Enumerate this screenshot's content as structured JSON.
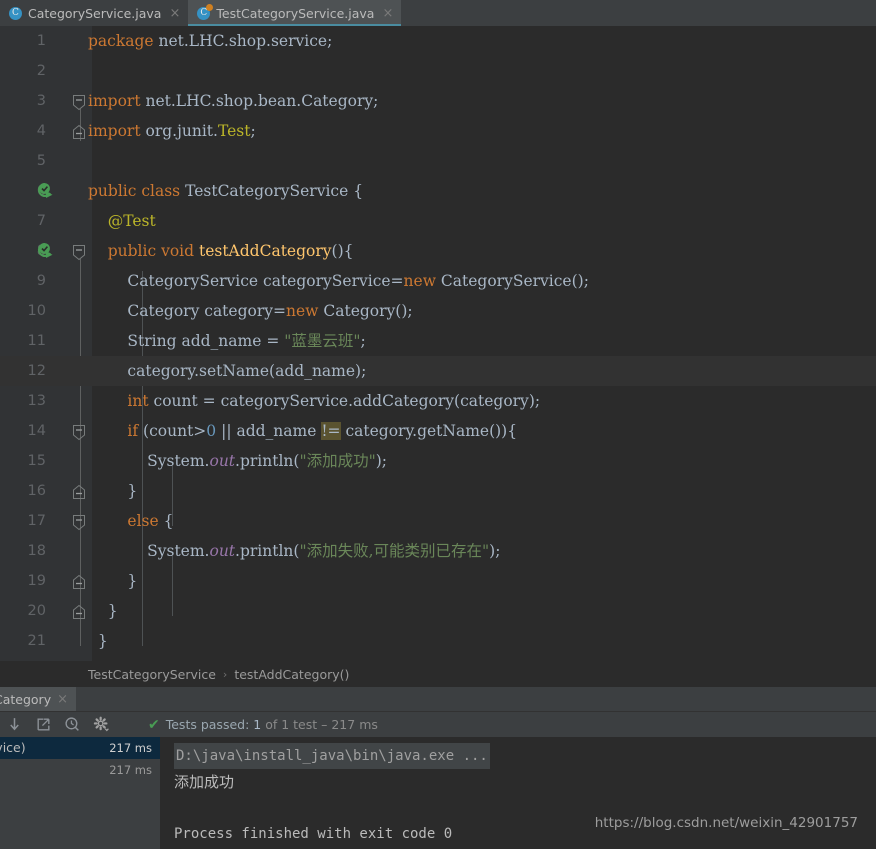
{
  "tabs": [
    {
      "label": "CategoryService.java",
      "icon": "java-class-icon",
      "active": false,
      "badge": ""
    },
    {
      "label": "TestCategoryService.java",
      "icon": "java-class-icon",
      "active": true,
      "badge": "run-badge"
    }
  ],
  "editor": {
    "lines": [
      {
        "n": "1",
        "tokens": [
          {
            "t": "package ",
            "c": "kw"
          },
          {
            "t": "net.LHC.shop.service;",
            "c": "pl"
          }
        ],
        "indent": 0,
        "gutter_run": false,
        "fold": ""
      },
      {
        "n": "2",
        "tokens": [],
        "indent": 0,
        "gutter_run": false,
        "fold": ""
      },
      {
        "n": "3",
        "tokens": [
          {
            "t": "import ",
            "c": "kw"
          },
          {
            "t": "net.LHC.shop.bean.Category;",
            "c": "pl"
          }
        ],
        "indent": 0,
        "gutter_run": false,
        "fold": "collapse-top"
      },
      {
        "n": "4",
        "tokens": [
          {
            "t": "import ",
            "c": "kw"
          },
          {
            "t": "org.junit.",
            "c": "pl"
          },
          {
            "t": "Test",
            "c": "ann"
          },
          {
            "t": ";",
            "c": "pl"
          }
        ],
        "indent": 0,
        "gutter_run": false,
        "fold": "collapse-bottom"
      },
      {
        "n": "5",
        "tokens": [],
        "indent": 0,
        "gutter_run": false,
        "fold": ""
      },
      {
        "n": "6",
        "tokens": [
          {
            "t": "public class ",
            "c": "kw"
          },
          {
            "t": "TestCategoryService ",
            "c": "pl"
          },
          {
            "t": "{",
            "c": "pl"
          }
        ],
        "indent": 0,
        "gutter_run": true,
        "fold": ""
      },
      {
        "n": "7",
        "tokens": [
          {
            "t": "    @Test",
            "c": "ann"
          }
        ],
        "indent": 0,
        "gutter_run": false,
        "fold": ""
      },
      {
        "n": "8",
        "tokens": [
          {
            "t": "    ",
            "c": "pl"
          },
          {
            "t": "public void ",
            "c": "kw"
          },
          {
            "t": "testAddCategory",
            "c": "fn"
          },
          {
            "t": "(){",
            "c": "pl"
          }
        ],
        "indent": 0,
        "gutter_run": true,
        "fold": "collapse-top"
      },
      {
        "n": "9",
        "tokens": [
          {
            "t": "        CategoryService categoryService=",
            "c": "pl"
          },
          {
            "t": "new ",
            "c": "kw"
          },
          {
            "t": "CategoryService();",
            "c": "pl"
          }
        ],
        "indent": 0,
        "gutter_run": false,
        "fold": ""
      },
      {
        "n": "10",
        "tokens": [
          {
            "t": "        Category category=",
            "c": "pl"
          },
          {
            "t": "new ",
            "c": "kw"
          },
          {
            "t": "Category();",
            "c": "pl"
          }
        ],
        "indent": 0,
        "gutter_run": false,
        "fold": ""
      },
      {
        "n": "11",
        "tokens": [
          {
            "t": "        String add_name = ",
            "c": "pl"
          },
          {
            "t": "\"蓝墨云班\"",
            "c": "str"
          },
          {
            "t": ";",
            "c": "pl"
          }
        ],
        "indent": 0,
        "gutter_run": false,
        "fold": ""
      },
      {
        "n": "12",
        "tokens": [
          {
            "t": "        category.setName(add_name);",
            "c": "pl"
          }
        ],
        "indent": 0,
        "gutter_run": false,
        "fold": "",
        "current": true
      },
      {
        "n": "13",
        "tokens": [
          {
            "t": "        ",
            "c": "pl"
          },
          {
            "t": "int ",
            "c": "kw"
          },
          {
            "t": "count = categoryService.addCategory(category);",
            "c": "pl"
          }
        ],
        "indent": 0,
        "gutter_run": false,
        "fold": ""
      },
      {
        "n": "14",
        "tokens": [
          {
            "t": "        ",
            "c": "pl"
          },
          {
            "t": "if ",
            "c": "kw"
          },
          {
            "t": "(count>",
            "c": "pl"
          },
          {
            "t": "0",
            "c": "num"
          },
          {
            "t": " || add_name ",
            "c": "pl"
          },
          {
            "t": "!=",
            "c": "hl"
          },
          {
            "t": " category.getName()){",
            "c": "pl"
          }
        ],
        "indent": 0,
        "gutter_run": false,
        "fold": "collapse-top"
      },
      {
        "n": "15",
        "tokens": [
          {
            "t": "            System.",
            "c": "pl"
          },
          {
            "t": "out",
            "c": "fld"
          },
          {
            "t": ".println(",
            "c": "pl"
          },
          {
            "t": "\"添加成功\"",
            "c": "str"
          },
          {
            "t": ");",
            "c": "pl"
          }
        ],
        "indent": 0,
        "gutter_run": false,
        "fold": ""
      },
      {
        "n": "16",
        "tokens": [
          {
            "t": "        }",
            "c": "pl"
          }
        ],
        "indent": 0,
        "gutter_run": false,
        "fold": "collapse-bottom"
      },
      {
        "n": "17",
        "tokens": [
          {
            "t": "        ",
            "c": "pl"
          },
          {
            "t": "else ",
            "c": "kw"
          },
          {
            "t": "{",
            "c": "pl"
          }
        ],
        "indent": 0,
        "gutter_run": false,
        "fold": "collapse-top"
      },
      {
        "n": "18",
        "tokens": [
          {
            "t": "            System.",
            "c": "pl"
          },
          {
            "t": "out",
            "c": "fld"
          },
          {
            "t": ".println(",
            "c": "pl"
          },
          {
            "t": "\"添加失败,可能类别已存在\"",
            "c": "str"
          },
          {
            "t": ");",
            "c": "pl"
          }
        ],
        "indent": 0,
        "gutter_run": false,
        "fold": ""
      },
      {
        "n": "19",
        "tokens": [
          {
            "t": "        }",
            "c": "pl"
          }
        ],
        "indent": 0,
        "gutter_run": false,
        "fold": "collapse-bottom"
      },
      {
        "n": "20",
        "tokens": [
          {
            "t": "    }",
            "c": "pl"
          }
        ],
        "indent": 0,
        "gutter_run": false,
        "fold": "collapse-bottom"
      },
      {
        "n": "21",
        "tokens": [
          {
            "t": "  }",
            "c": "pl"
          }
        ],
        "indent": 0,
        "gutter_run": false,
        "fold": ""
      }
    ]
  },
  "breadcrumb": {
    "class": "TestCategoryService",
    "separator": "›",
    "method": "testAddCategory()"
  },
  "run_window": {
    "tab_label": "Category",
    "tab_close": "×",
    "toolbar_icons": [
      "scroll-down-icon",
      "export-icon",
      "search-history-icon",
      "settings-gear-icon"
    ],
    "status": {
      "check": "✔",
      "passed_label": "Tests passed: ",
      "count": "1",
      "of_label": " of 1 test ",
      "dash": "– ",
      "duration": "217 ms"
    },
    "tree": [
      {
        "label": ".shop.service)",
        "time": "217 ms",
        "selected": true
      },
      {
        "label": "",
        "time": "217 ms",
        "selected": false
      }
    ],
    "console": [
      {
        "text": "D:\\java\\install_java\\bin\\java.exe ...",
        "style": "cmd"
      },
      {
        "text": "添加成功",
        "style": "cjk"
      },
      {
        "text": "",
        "style": "plain"
      },
      {
        "text": "Process finished with exit code 0",
        "style": "plain"
      }
    ]
  },
  "watermark": "https://blog.csdn.net/weixin_42901757"
}
